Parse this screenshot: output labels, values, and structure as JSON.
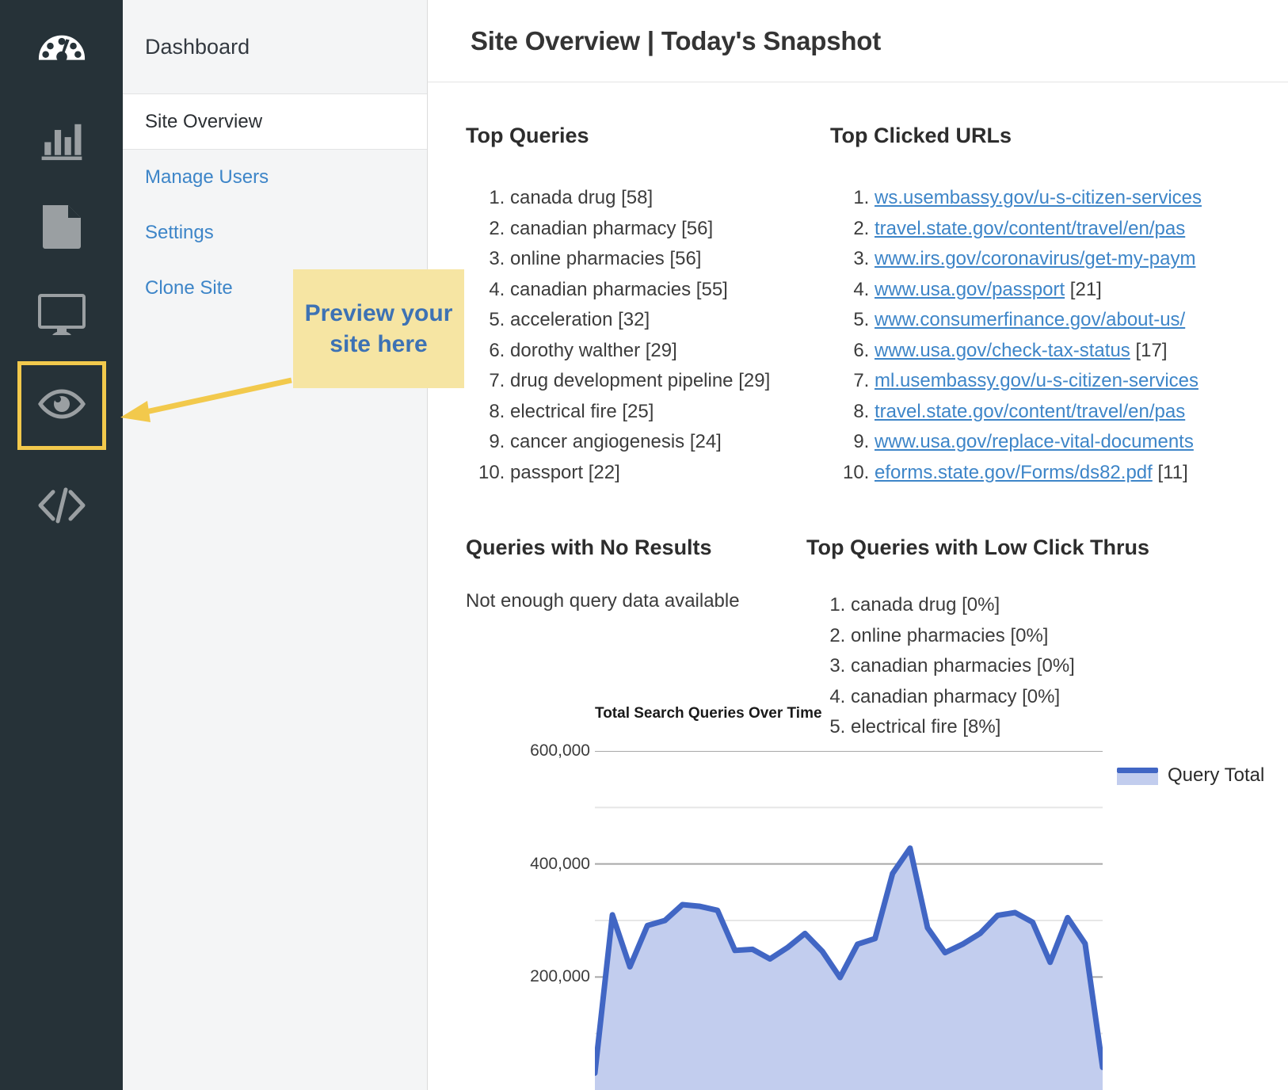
{
  "rail": {
    "items": [
      {
        "icon": "gauge-icon",
        "name": "dashboard",
        "active": true,
        "highlight": false
      },
      {
        "icon": "bar-chart-icon",
        "name": "analytics",
        "active": false,
        "highlight": false
      },
      {
        "icon": "document-icon",
        "name": "content",
        "active": false,
        "highlight": false
      },
      {
        "icon": "monitor-icon",
        "name": "display",
        "active": false,
        "highlight": false
      },
      {
        "icon": "eye-icon",
        "name": "preview",
        "active": false,
        "highlight": true
      },
      {
        "icon": "code-icon",
        "name": "code",
        "active": false,
        "highlight": false
      }
    ]
  },
  "nav": {
    "header": "Dashboard",
    "items": [
      {
        "label": "Site Overview",
        "active": true
      },
      {
        "label": "Manage Users",
        "active": false
      },
      {
        "label": "Settings",
        "active": false
      },
      {
        "label": "Clone Site",
        "active": false
      }
    ]
  },
  "header": {
    "title": "Site Overview | Today's Snapshot"
  },
  "callout": {
    "text": "Preview your site here",
    "bg_color": "#f6e5a3",
    "text_color": "#3d72b4",
    "arrow_color": "#f2c94c"
  },
  "top_queries": {
    "title": "Top Queries",
    "items": [
      "canada drug [58]",
      "canadian pharmacy [56]",
      "online pharmacies [56]",
      "canadian pharmacies [55]",
      "acceleration [32]",
      "dorothy walther [29]",
      "drug development pipeline [29]",
      "electrical fire [25]",
      "cancer angiogenesis [24]",
      "passport [22]"
    ]
  },
  "top_clicked_urls": {
    "title": "Top Clicked URLs",
    "items": [
      {
        "url": "ws.usembassy.gov/u-s-citizen-services",
        "count": ""
      },
      {
        "url": "travel.state.gov/content/travel/en/pas",
        "count": ""
      },
      {
        "url": "www.irs.gov/coronavirus/get-my-paym",
        "count": ""
      },
      {
        "url": "www.usa.gov/passport",
        "count": "[21]"
      },
      {
        "url": "www.consumerfinance.gov/about-us/",
        "count": ""
      },
      {
        "url": "www.usa.gov/check-tax-status",
        "count": "[17]"
      },
      {
        "url": "ml.usembassy.gov/u-s-citizen-services",
        "count": ""
      },
      {
        "url": "travel.state.gov/content/travel/en/pas",
        "count": ""
      },
      {
        "url": "www.usa.gov/replace-vital-documents",
        "count": ""
      },
      {
        "url": "eforms.state.gov/Forms/ds82.pdf",
        "count": "[11]"
      }
    ]
  },
  "no_results": {
    "title": "Queries with No Results",
    "message": "Not enough query data available"
  },
  "low_click_thrus": {
    "title": "Top Queries with Low Click Thrus",
    "items": [
      "canada drug [0%]",
      "online pharmacies [0%]",
      "canadian pharmacies [0%]",
      "canadian pharmacy [0%]",
      "electrical fire [8%]"
    ]
  },
  "chart_data": {
    "type": "area",
    "title": "Total Search Queries Over Time",
    "xlabel": "",
    "ylabel": "",
    "ylim": [
      0,
      600000
    ],
    "grid": true,
    "gridlines": [
      600000,
      500000,
      400000,
      300000,
      200000,
      100000
    ],
    "tick_labels": [
      "600,000",
      "400,000",
      "200,000"
    ],
    "ticks": [
      600000,
      400000,
      200000
    ],
    "legend_position": "right",
    "line_color": "#4166c4",
    "fill_color": "#c2cdee",
    "series": [
      {
        "name": "Query Total",
        "values": [
          30000,
          310000,
          218000,
          291000,
          300000,
          328000,
          325000,
          318000,
          247000,
          249000,
          232000,
          252000,
          277000,
          245000,
          199000,
          258000,
          268000,
          383000,
          428000,
          287000,
          243000,
          258000,
          277000,
          309000,
          314000,
          297000,
          226000,
          305000,
          259000,
          40000
        ]
      }
    ]
  }
}
